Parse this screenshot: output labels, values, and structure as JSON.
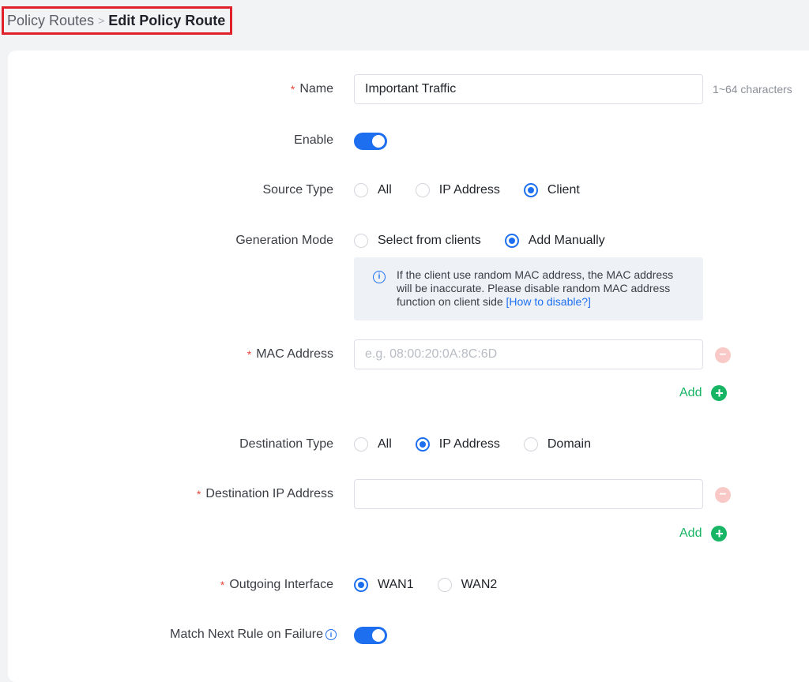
{
  "breadcrumb": {
    "parent": "Policy Routes",
    "separator": ">",
    "current": "Edit Policy Route"
  },
  "form": {
    "name": {
      "label": "Name",
      "required": true,
      "value": "Important Traffic",
      "hint": "1~64 characters"
    },
    "enable": {
      "label": "Enable",
      "on": true
    },
    "source_type": {
      "label": "Source Type",
      "options": [
        "All",
        "IP Address",
        "Client"
      ],
      "selected": "Client"
    },
    "generation_mode": {
      "label": "Generation Mode",
      "options": [
        "Select from clients",
        "Add Manually"
      ],
      "selected": "Add Manually"
    },
    "notice": {
      "text": "If the client use random MAC address, the MAC address will be inaccurate. Please disable random MAC address function on client side",
      "link": "[How to disable?]"
    },
    "mac_address": {
      "label": "MAC Address",
      "required": true,
      "value": "",
      "placeholder": "e.g. 08:00:20:0A:8C:6D",
      "add_label": "Add"
    },
    "destination_type": {
      "label": "Destination Type",
      "options": [
        "All",
        "IP Address",
        "Domain"
      ],
      "selected": "IP Address"
    },
    "destination_ip": {
      "label": "Destination IP Address",
      "required": true,
      "value": "",
      "placeholder": "",
      "add_label": "Add"
    },
    "outgoing_interface": {
      "label": "Outgoing Interface",
      "required": true,
      "options": [
        "WAN1",
        "WAN2"
      ],
      "selected": "WAN1"
    },
    "match_next_rule": {
      "label": "Match Next Rule on Failure",
      "on": true
    }
  },
  "colors": {
    "accent": "#1e6ff0",
    "required": "#e5483d",
    "add_green": "#18b564",
    "highlight_border": "#e0202a"
  },
  "icons": {
    "info": "info-icon",
    "minus": "minus-circle-icon",
    "plus": "plus-circle-icon",
    "separator": "chevron-right-icon"
  }
}
